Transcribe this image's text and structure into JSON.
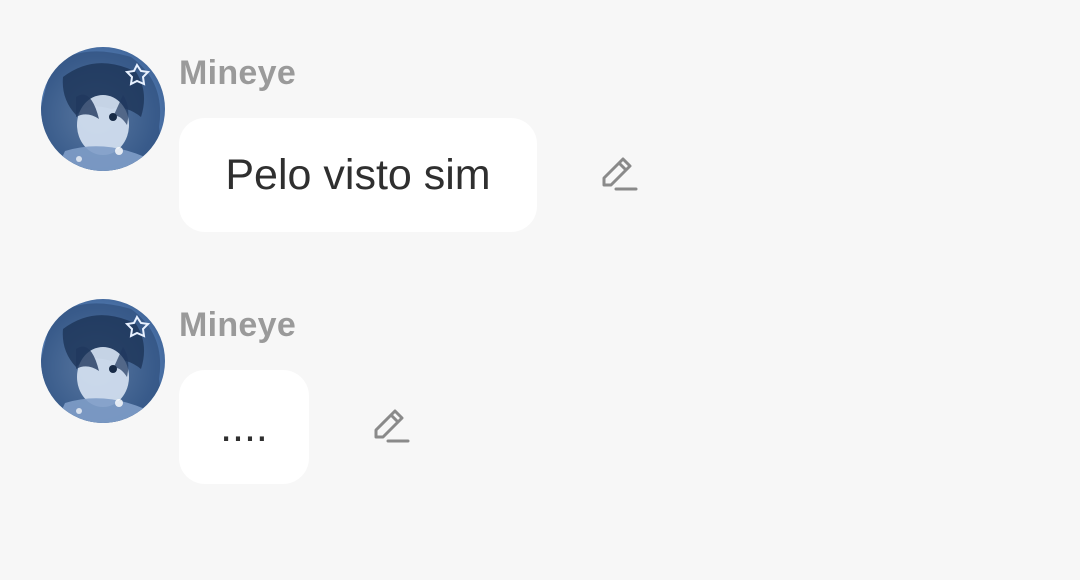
{
  "messages": [
    {
      "username": "Mineye",
      "text": "Pelo visto sim",
      "avatar_icon": "user-avatar",
      "edit_icon": "pencil-icon"
    },
    {
      "username": "Mineye",
      "text": "....",
      "avatar_icon": "user-avatar",
      "edit_icon": "pencil-icon"
    }
  ],
  "colors": {
    "background": "#f7f7f7",
    "bubble": "#ffffff",
    "username": "#9a9a9a",
    "message_text": "#2f2f2f",
    "icon": "#8a8a8a"
  }
}
